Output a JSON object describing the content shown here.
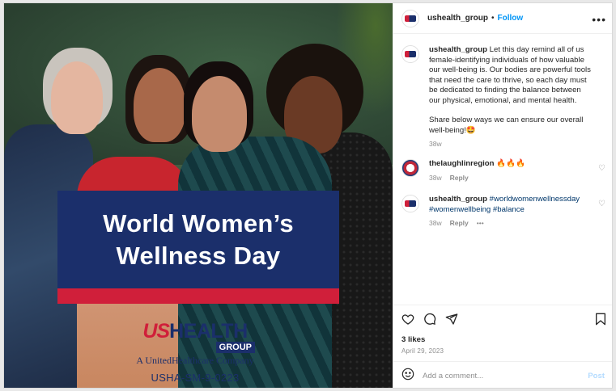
{
  "image": {
    "banner_line1": "World Women’s",
    "banner_line2": "Wellness Day",
    "logo_us": "US",
    "logo_health": "HEALTH",
    "logo_group": "GROUP",
    "logo_sub": "A UnitedHealthcare Company",
    "logo_code": "USHA-SM-9-0223"
  },
  "header": {
    "username": "ushealth_group",
    "separator": "•",
    "follow_label": "Follow",
    "more": "•••"
  },
  "comments": [
    {
      "username": "ushealth_group",
      "text": "Let this day remind all of us female-identifying individuals of how valuable our well-being is. Our bodies are powerful tools that need the care to thrive, so each day must be dedicated to finding the balance between our physical, emotional, and mental health.",
      "text2": "Share below ways we can ensure our overall well-being!🤩",
      "time": "38w"
    },
    {
      "username": "thelaughlinregion",
      "text": "🔥🔥🔥",
      "time": "38w",
      "reply": "Reply"
    },
    {
      "username": "ushealth_group",
      "hashtags": "#worldwomenwellnessday #womenwellbeing #balance",
      "time": "38w",
      "reply": "Reply",
      "more": "•••"
    }
  ],
  "actions": {
    "likes": "3 likes",
    "date": "April 29, 2023"
  },
  "add_comment": {
    "placeholder": "Add a comment...",
    "post_label": "Post"
  },
  "colors": {
    "brand_blue": "#1b2f6b",
    "brand_red": "#d01f3a",
    "link_blue": "#0095f6"
  }
}
